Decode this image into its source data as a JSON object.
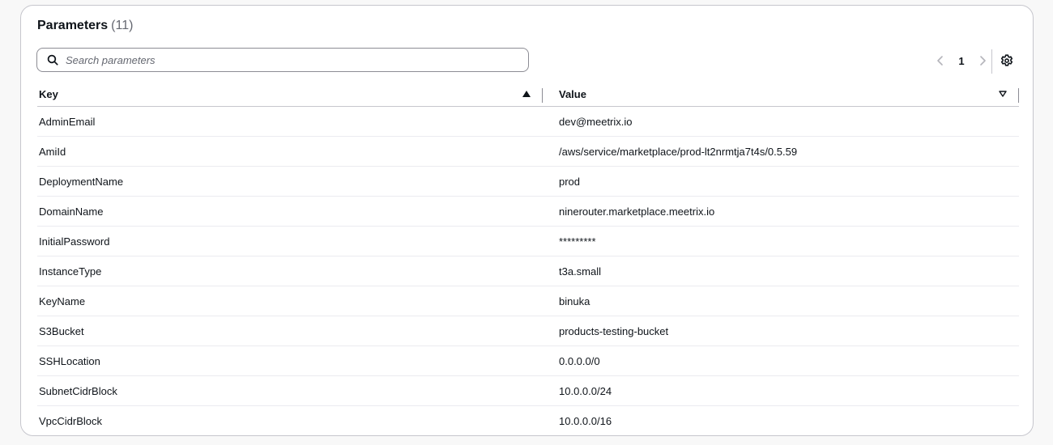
{
  "panel": {
    "title": "Parameters",
    "count": "(11)"
  },
  "search": {
    "placeholder": "Search parameters",
    "icon": "search-icon"
  },
  "pagination": {
    "current_page": "1",
    "prev_icon": "chevron-left-icon",
    "next_icon": "chevron-right-icon"
  },
  "settings": {
    "icon": "gear-icon"
  },
  "table": {
    "columns": [
      {
        "label": "Key",
        "sort": "ascending"
      },
      {
        "label": "Value",
        "sort": "none"
      }
    ],
    "rows": [
      {
        "key": "AdminEmail",
        "value": "dev@meetrix.io"
      },
      {
        "key": "AmiId",
        "value": "/aws/service/marketplace/prod-lt2nrmtja7t4s/0.5.59"
      },
      {
        "key": "DeploymentName",
        "value": "prod"
      },
      {
        "key": "DomainName",
        "value": "ninerouter.marketplace.meetrix.io"
      },
      {
        "key": "InitialPassword",
        "value": "*********"
      },
      {
        "key": "InstanceType",
        "value": "t3a.small"
      },
      {
        "key": "KeyName",
        "value": "binuka"
      },
      {
        "key": "S3Bucket",
        "value": "products-testing-bucket"
      },
      {
        "key": "SSHLocation",
        "value": "0.0.0.0/0"
      },
      {
        "key": "SubnetCidrBlock",
        "value": "10.0.0.0/24"
      },
      {
        "key": "VpcCidrBlock",
        "value": "10.0.0.0/16"
      }
    ]
  },
  "colors": {
    "text": "#0f141a",
    "muted": "#656871",
    "border": "#c6c6cd",
    "row_divider": "#ebebf0",
    "disabled_arrow": "#b4b4bb"
  }
}
